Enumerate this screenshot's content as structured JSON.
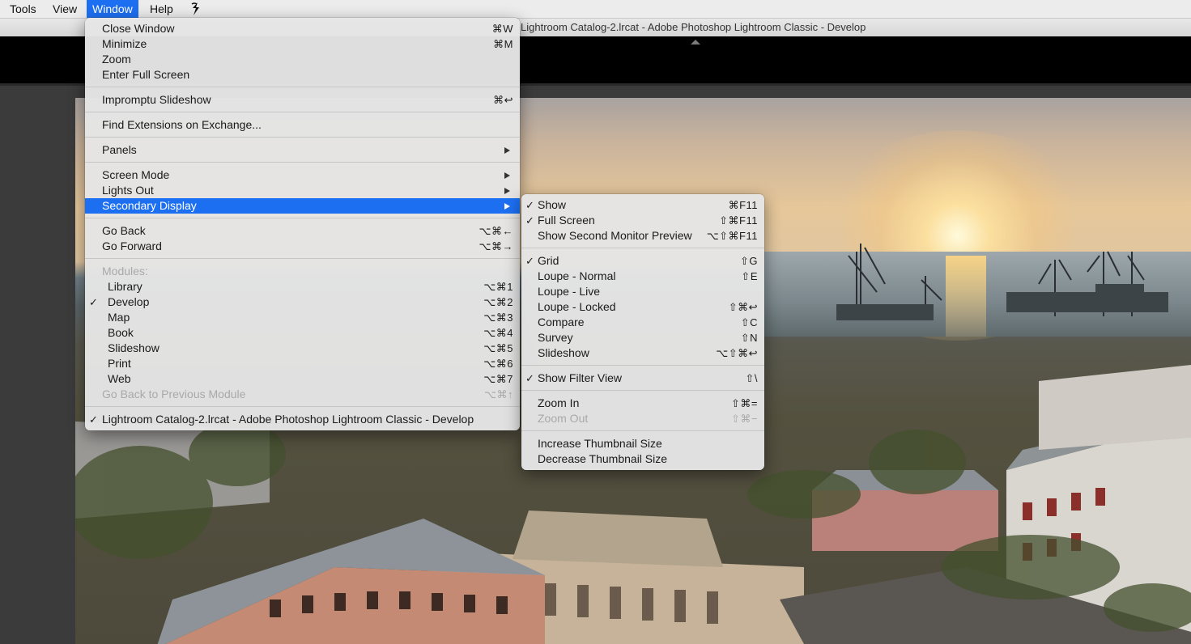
{
  "menubar": {
    "items": [
      "Tools",
      "View",
      "Window",
      "Help"
    ],
    "extra_icon": "script-icon"
  },
  "window_title": "Lightroom Catalog-2.lrcat - Adobe Photoshop Lightroom Classic - Develop",
  "window_menu": {
    "groups": [
      [
        {
          "label": "Close Window",
          "shortcut": "⌘W"
        },
        {
          "label": "Minimize",
          "shortcut": "⌘M"
        },
        {
          "label": "Zoom",
          "shortcut": ""
        },
        {
          "label": "Enter Full Screen",
          "shortcut": ""
        }
      ],
      [
        {
          "label": "Impromptu Slideshow",
          "shortcut": "⌘↩"
        }
      ],
      [
        {
          "label": "Find Extensions on Exchange...",
          "shortcut": ""
        }
      ],
      [
        {
          "label": "Panels",
          "submenu": true
        }
      ],
      [
        {
          "label": "Screen Mode",
          "submenu": true
        },
        {
          "label": "Lights Out",
          "submenu": true
        },
        {
          "label": "Secondary Display",
          "submenu": true,
          "highlighted": true
        }
      ],
      [
        {
          "label": "Go Back",
          "shortcut": "⌥⌘←"
        },
        {
          "label": "Go Forward",
          "shortcut": "⌥⌘→"
        }
      ],
      [
        {
          "label": "Modules:",
          "disabled": true,
          "header": true
        },
        {
          "label": "Library",
          "shortcut": "⌥⌘1",
          "indent": true
        },
        {
          "label": "Develop",
          "shortcut": "⌥⌘2",
          "indent": true,
          "checked": true
        },
        {
          "label": "Map",
          "shortcut": "⌥⌘3",
          "indent": true
        },
        {
          "label": "Book",
          "shortcut": "⌥⌘4",
          "indent": true
        },
        {
          "label": "Slideshow",
          "shortcut": "⌥⌘5",
          "indent": true
        },
        {
          "label": "Print",
          "shortcut": "⌥⌘6",
          "indent": true
        },
        {
          "label": "Web",
          "shortcut": "⌥⌘7",
          "indent": true
        },
        {
          "label": "Go Back to Previous Module",
          "shortcut": "⌥⌘↑",
          "disabled": true
        }
      ],
      [
        {
          "label": "Lightroom Catalog-2.lrcat - Adobe Photoshop Lightroom Classic - Develop",
          "checked": true
        }
      ]
    ]
  },
  "secondary_display_menu": {
    "groups": [
      [
        {
          "label": "Show",
          "shortcut": "⌘F11",
          "checked": true
        },
        {
          "label": "Full Screen",
          "shortcut": "⇧⌘F11",
          "checked": true
        },
        {
          "label": "Show Second Monitor Preview",
          "shortcut": "⌥⇧⌘F11"
        }
      ],
      [
        {
          "label": "Grid",
          "shortcut": "⇧G",
          "checked": true
        },
        {
          "label": "Loupe - Normal",
          "shortcut": "⇧E"
        },
        {
          "label": "Loupe - Live",
          "shortcut": ""
        },
        {
          "label": "Loupe - Locked",
          "shortcut": "⇧⌘↩"
        },
        {
          "label": "Compare",
          "shortcut": "⇧C"
        },
        {
          "label": "Survey",
          "shortcut": "⇧N"
        },
        {
          "label": "Slideshow",
          "shortcut": "⌥⇧⌘↩"
        }
      ],
      [
        {
          "label": "Show Filter View",
          "shortcut": "⇧\\",
          "checked": true
        }
      ],
      [
        {
          "label": "Zoom In",
          "shortcut": "⇧⌘="
        },
        {
          "label": "Zoom Out",
          "shortcut": "⇧⌘−",
          "disabled": true
        }
      ],
      [
        {
          "label": "Increase Thumbnail Size",
          "shortcut": ""
        },
        {
          "label": "Decrease Thumbnail Size",
          "shortcut": ""
        }
      ]
    ]
  },
  "checkmark": "✓",
  "colors": {
    "highlight": "#1d6ff2",
    "menu_bg": "#e5e5e5",
    "disabled_text": "#a9a9a9"
  }
}
